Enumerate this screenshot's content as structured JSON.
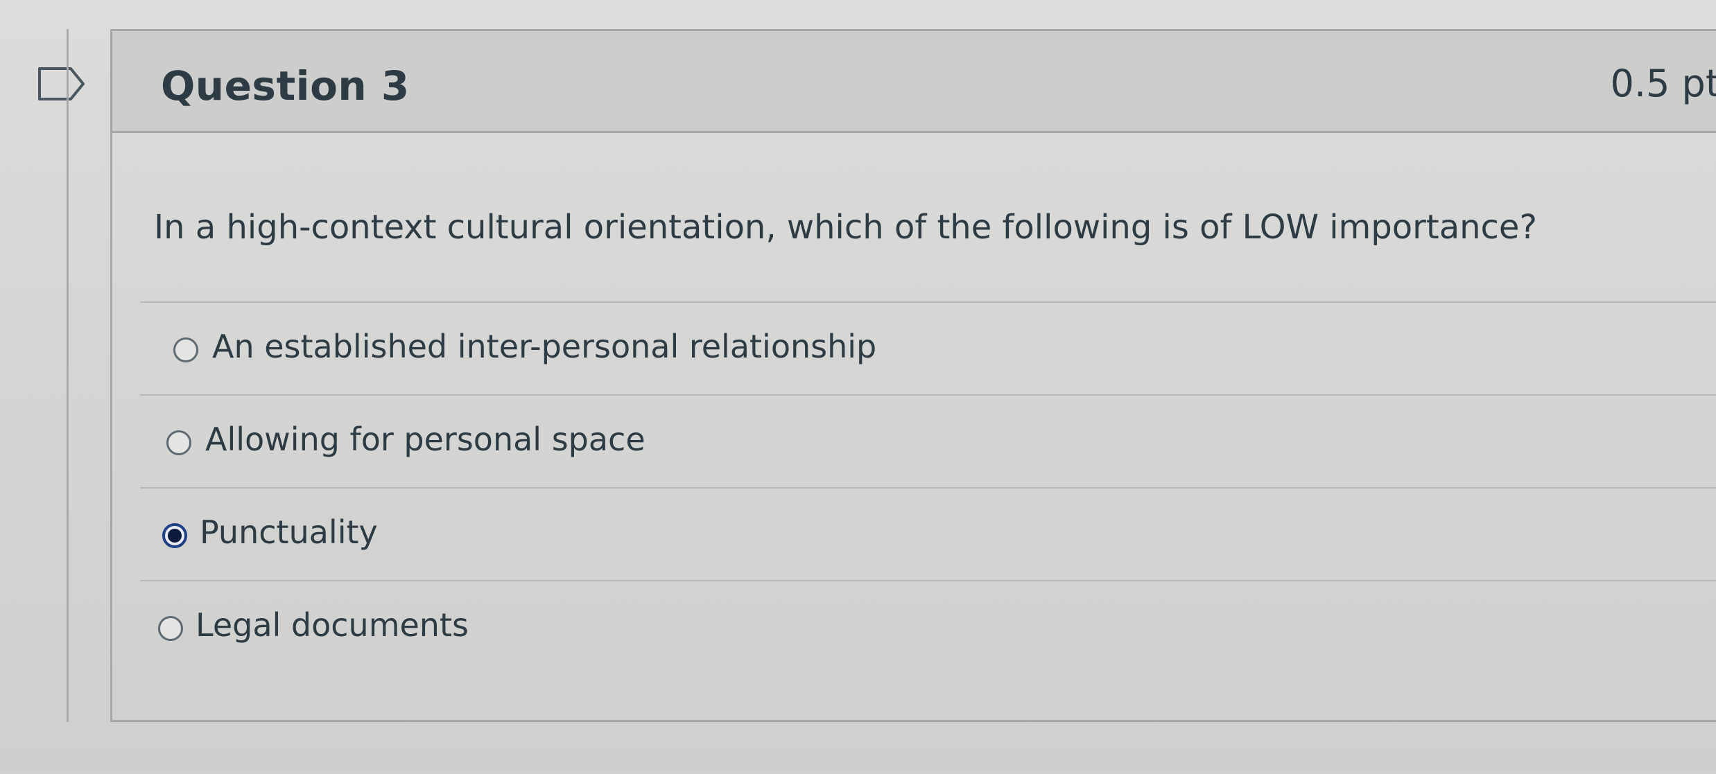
{
  "question": {
    "title": "Question 3",
    "points": "0.5 pt",
    "text": "In a high-context cultural orientation, which of the following is of LOW importance?",
    "answers": [
      {
        "label": "An established inter-personal relationship",
        "selected": false
      },
      {
        "label": "Allowing for personal space",
        "selected": false
      },
      {
        "label": "Punctuality",
        "selected": true
      },
      {
        "label": "Legal documents",
        "selected": false
      }
    ]
  },
  "icons": {
    "flag": "flag-question-icon"
  },
  "colors": {
    "selected_radio": "#1f3f86",
    "text": "#2d3b45",
    "border": "#a5a8aa"
  }
}
